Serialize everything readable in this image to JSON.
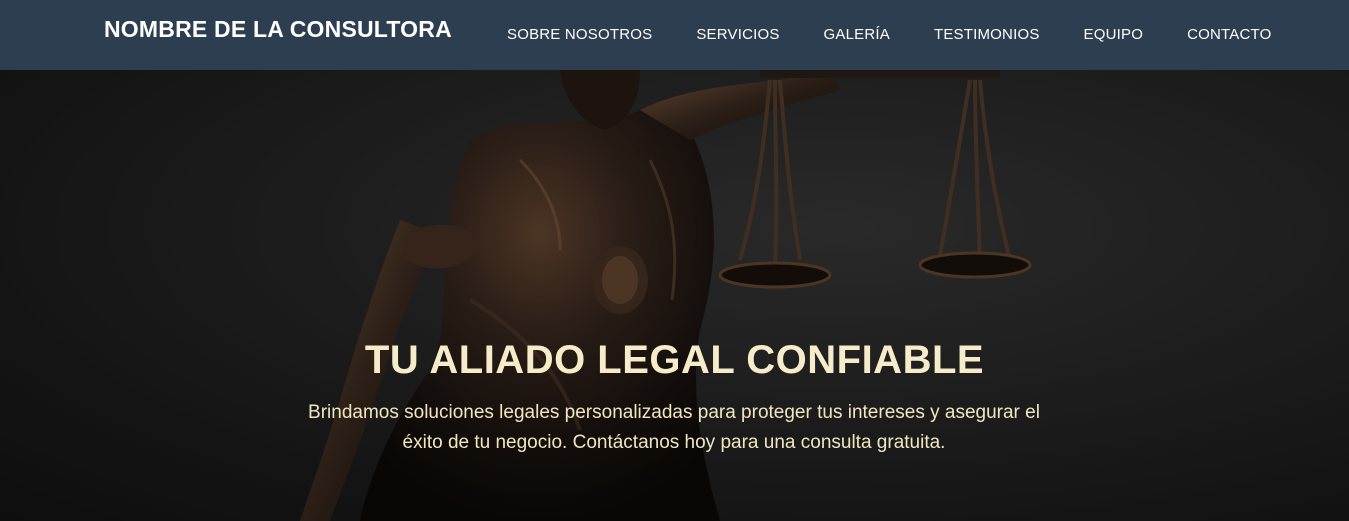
{
  "navbar": {
    "brand": "NOMBRE DE LA CONSULTORA",
    "background_color": "#2d3e51",
    "links": [
      {
        "label": "SOBRE NOSOTROS"
      },
      {
        "label": "SERVICIOS"
      },
      {
        "label": "GALERÍA"
      },
      {
        "label": "TESTIMONIOS"
      },
      {
        "label": "EQUIPO"
      },
      {
        "label": "CONTACTO"
      }
    ]
  },
  "hero": {
    "title": "TU ALIADO LEGAL CONFIABLE",
    "subtitle": "Brindamos soluciones legales personalizadas para proteger tus intereses y asegurar el éxito de tu negocio. Contáctanos hoy para una consulta gratuita.",
    "title_color": "#f6ecc9",
    "image_subject": "lady-justice-statue-with-scales"
  }
}
